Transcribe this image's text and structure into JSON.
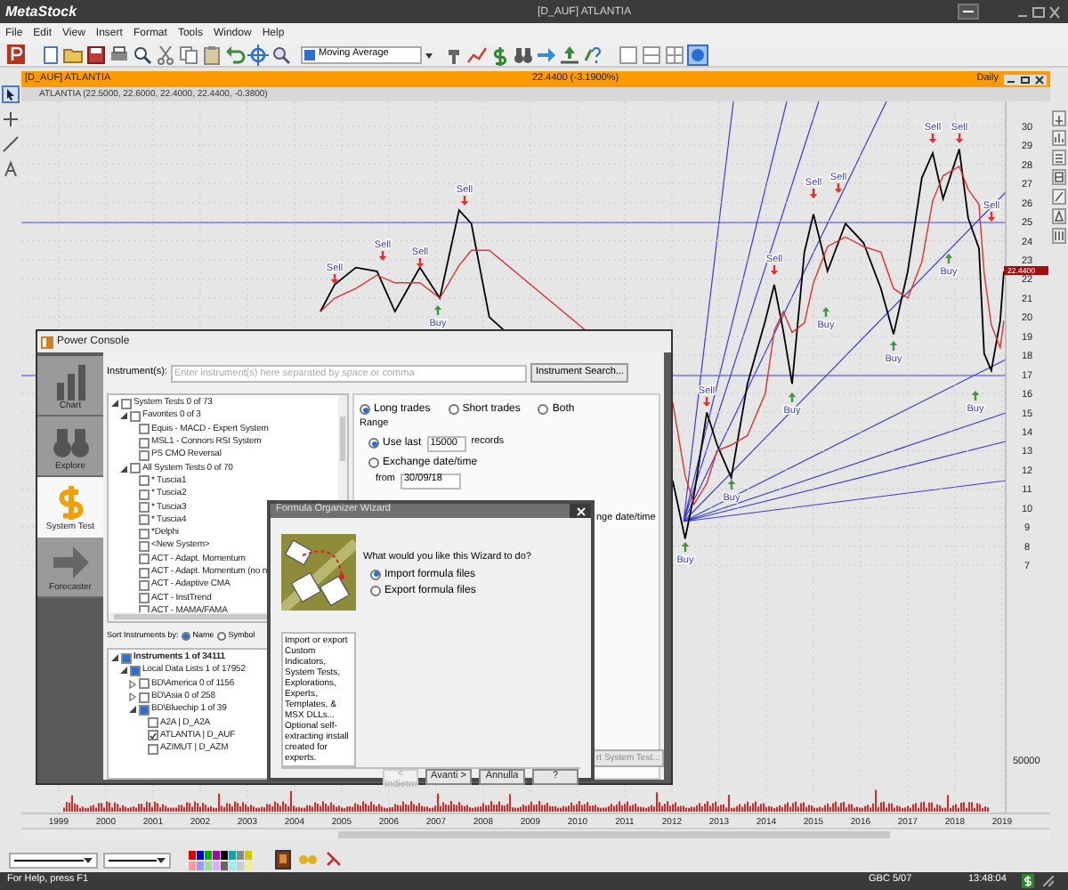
{
  "title_bar": {
    "app": "MetaStock",
    "document": "[D_AUF] ATLANTIA"
  },
  "menu": [
    "File",
    "Edit",
    "View",
    "Insert",
    "Format",
    "Tools",
    "Window",
    "Help"
  ],
  "toolbar": {
    "indicator": "Moving Average"
  },
  "chart_window": {
    "title": "[D_AUF] ATLANTIA",
    "quote": "22.4400 (-3.1900%)",
    "period": "Daily",
    "info": "ATLANTIA (22.5000, 22.6000, 22.4000, 22.4400, -0.3800)",
    "chart_data": {
      "type": "line",
      "x": [
        2004.55,
        2004.85,
        2005.3,
        2005.75,
        2006.13,
        2006.66,
        2007.08,
        2007.49,
        2007.75,
        2008.13,
        2012.02,
        2012.28,
        2012.47,
        2012.74,
        2012.96,
        2013.26,
        2013.6,
        2013.98,
        2014.17,
        2014.36,
        2014.55,
        2014.81,
        2015.0,
        2015.3,
        2015.68,
        2016.06,
        2016.43,
        2016.7,
        2017.0,
        2017.3,
        2017.53,
        2017.75,
        2018.09,
        2018.28,
        2018.51,
        2018.62,
        2018.77,
        2018.96,
        2019.04
      ],
      "series": [
        {
          "color": "#000000",
          "values": [
            20.3,
            21.7,
            22.6,
            22.4,
            20.3,
            22.6,
            21.0,
            25.6,
            24.9,
            20.0,
            11.4,
            8.4,
            10.7,
            15.0,
            13.3,
            11.6,
            16.5,
            19.8,
            21.7,
            19.3,
            16.5,
            23.4,
            25.4,
            22.4,
            24.9,
            23.9,
            21.5,
            19.1,
            22.4,
            27.3,
            28.6,
            26.2,
            28.8,
            25.2,
            23.6,
            18.1,
            17.2,
            19.8,
            22.4
          ]
        },
        {
          "color": "#e03030",
          "values": [
            20.3,
            21.0,
            21.5,
            22.2,
            21.8,
            21.8,
            21.0,
            22.7,
            23.5,
            23.5,
            15.5,
            11.7,
            10.2,
            11.3,
            13.0,
            13.3,
            13.8,
            16.0,
            19.3,
            20.3,
            19.2,
            19.7,
            21.8,
            23.7,
            24.2,
            23.7,
            23.4,
            21.5,
            21.0,
            22.9,
            26.1,
            27.4,
            27.9,
            26.7,
            25.9,
            22.3,
            19.6,
            18.4,
            19.8
          ]
        }
      ],
      "xlim": [
        1998.21,
        2020.02
      ],
      "ylim": [
        -6.0,
        31.3
      ],
      "grid": true,
      "yticks": [
        {
          "value": 30,
          "label": "30"
        },
        {
          "value": 29,
          "label": "29"
        },
        {
          "value": 28,
          "label": "28"
        },
        {
          "value": 27,
          "label": "27"
        },
        {
          "value": 26,
          "label": "26"
        },
        {
          "value": 25,
          "label": "25"
        },
        {
          "value": 24,
          "label": "24"
        },
        {
          "value": 23,
          "label": "23"
        },
        {
          "value": 22,
          "label": "22"
        },
        {
          "value": 21,
          "label": "21"
        },
        {
          "value": 20,
          "label": "20"
        },
        {
          "value": 19,
          "label": "19"
        },
        {
          "value": 18,
          "label": "18"
        },
        {
          "value": 17,
          "label": "17"
        },
        {
          "value": 16,
          "label": "16"
        },
        {
          "value": 15,
          "label": "15"
        },
        {
          "value": 14,
          "label": "14"
        },
        {
          "value": 13,
          "label": "13"
        },
        {
          "value": 12,
          "label": "12"
        },
        {
          "value": 11,
          "label": "11"
        },
        {
          "value": 10,
          "label": "10"
        },
        {
          "value": 9,
          "label": "9"
        },
        {
          "value": 8,
          "label": "8"
        },
        {
          "value": 7,
          "label": "7"
        }
      ],
      "xticks": [
        {
          "value": 1999,
          "label": "1999"
        },
        {
          "value": 2000,
          "label": "2000"
        },
        {
          "value": 2001,
          "label": "2001"
        },
        {
          "value": 2002,
          "label": "2002"
        },
        {
          "value": 2003,
          "label": "2003"
        },
        {
          "value": 2004,
          "label": "2004"
        },
        {
          "value": 2005,
          "label": "2005"
        },
        {
          "value": 2006,
          "label": "2006"
        },
        {
          "value": 2007,
          "label": "2007"
        },
        {
          "value": 2008,
          "label": "2008"
        },
        {
          "value": 2009,
          "label": "2009"
        },
        {
          "value": 2010,
          "label": "2010"
        },
        {
          "value": 2011,
          "label": "2011"
        },
        {
          "value": 2012,
          "label": "2012"
        },
        {
          "value": 2013,
          "label": "2013"
        },
        {
          "value": 2014,
          "label": "2014"
        },
        {
          "value": 2015,
          "label": "2015"
        },
        {
          "value": 2016,
          "label": "2016"
        },
        {
          "value": 2017,
          "label": "2017"
        },
        {
          "value": 2018,
          "label": "2018"
        },
        {
          "value": 2019,
          "label": "2019"
        }
      ]
    },
    "price_tag": "22.4400",
    "signals": [
      {
        "kind": "sell",
        "label": "Sell"
      },
      {
        "kind": "sell",
        "label": "Sell"
      },
      {
        "kind": "sell",
        "label": "Sell"
      },
      {
        "kind": "buy",
        "label": "Buy"
      },
      {
        "kind": "sell",
        "label": "Sell"
      },
      {
        "kind": "buy",
        "label": "Buy"
      },
      {
        "kind": "sell",
        "label": "Sell"
      },
      {
        "kind": "buy",
        "label": "Buy"
      },
      {
        "kind": "sell",
        "label": "Sell"
      },
      {
        "kind": "buy",
        "label": "Buy"
      },
      {
        "kind": "sell",
        "label": "Sell"
      },
      {
        "kind": "buy",
        "label": "Buy"
      },
      {
        "kind": "sell",
        "label": "Sell"
      },
      {
        "kind": "buy",
        "label": "Buy"
      },
      {
        "kind": "sell",
        "label": "Sell"
      },
      {
        "kind": "buy",
        "label": "Buy"
      },
      {
        "kind": "sell",
        "label": "Sell"
      },
      {
        "kind": "buy",
        "label": "Buy"
      },
      {
        "kind": "sell",
        "label": "Sell"
      }
    ],
    "volume_label": "50000"
  },
  "power_console": {
    "title": "Power Console",
    "nav": [
      {
        "label": "Chart",
        "selected": false
      },
      {
        "label": "Explore",
        "selected": false
      },
      {
        "label": "System Test",
        "selected": true
      },
      {
        "label": "Forecaster",
        "selected": false
      }
    ],
    "instrument_label": "Instrument(s):",
    "instrument_placeholder": "Enter instrument(s) here separated by space or comma",
    "search_button": "Instrument Search...",
    "system_tests": [
      {
        "label": "System Tests 0 of 73",
        "checked": false,
        "expanded": true,
        "children": [
          {
            "label": "Favorites 0 of 3",
            "checked": false,
            "expanded": true,
            "children": [
              {
                "label": "Equis - MACD - Expert System",
                "checked": false
              },
              {
                "label": "MSL1 - Connors RSI System",
                "checked": false
              },
              {
                "label": "PS CMO Reversal",
                "checked": false
              }
            ]
          },
          {
            "label": "All System Tests 0 of 70",
            "checked": false,
            "expanded": true,
            "children": [
              {
                "label": "* Tuscia1",
                "checked": false
              },
              {
                "label": "* Tuscia2",
                "checked": false
              },
              {
                "label": "* Tuscia3",
                "checked": false
              },
              {
                "label": "* Tuscia4",
                "checked": false
              },
              {
                "label": "*Delphi",
                "checked": false
              },
              {
                "label": "<New System>",
                "checked": false
              },
              {
                "label": "ACT - Adapt. Momentum",
                "checked": false
              },
              {
                "label": "ACT - Adapt. Momentum (no n",
                "checked": false
              },
              {
                "label": "ACT - Adaptive CMA",
                "checked": false
              },
              {
                "label": "ACT - InstTrend",
                "checked": false
              },
              {
                "label": "ACT - MAMA/FAMA",
                "checked": false
              }
            ]
          }
        ]
      }
    ],
    "sort_label": "Sort Instruments by:",
    "sort_options": [
      {
        "label": "Name",
        "selected": true
      },
      {
        "label": "Symbol",
        "selected": false
      }
    ],
    "instruments": [
      {
        "label": "Instruments 1 of 34111",
        "bold": true,
        "checked": false,
        "partial": true,
        "expanded": true,
        "children": [
          {
            "label": "Local Data Lists 1 of 17952",
            "checked": false,
            "partial": true,
            "expanded": true,
            "children": [
              {
                "label": "BD\\America 0 of 1156",
                "checked": false,
                "expanded": false
              },
              {
                "label": "BD\\Asia 0 of 258",
                "checked": false,
                "expanded": false
              },
              {
                "label": "BD\\Bluechip 1 of 39",
                "checked": false,
                "partial": true,
                "expanded": true,
                "children": [
                  {
                    "label": "A2A | D_A2A",
                    "checked": false
                  },
                  {
                    "label": "ATLANTIA | D_AUF",
                    "checked": true
                  },
                  {
                    "label": "AZIMUT | D_AZM",
                    "checked": false
                  }
                ]
              }
            ]
          }
        ]
      }
    ],
    "trade_options": [
      {
        "label": "Long trades",
        "selected": true
      },
      {
        "label": "Short trades",
        "selected": false
      },
      {
        "label": "Both",
        "selected": false
      }
    ],
    "range_label": "Range",
    "range_options": [
      {
        "label": "Use last",
        "selected": true
      },
      {
        "label": "Exchange date/time",
        "selected": false
      }
    ],
    "records_value": "15000",
    "records_label": "records",
    "from_label": "from",
    "from_value": "30/09/18",
    "hidden_option": "nge date/time",
    "run_button": "rt System Test..."
  },
  "wizard": {
    "title": "Formula Organizer Wizard",
    "description": "Import or export Custom Indicators, System Tests, Explorations, Experts, Templates, & MSX DLLs... Optional self-extracting install created for experts.",
    "question": "What would you like this Wizard to do?",
    "options": [
      {
        "label": "Import formula files",
        "selected": true
      },
      {
        "label": "Export formula files",
        "selected": false
      }
    ],
    "buttons": [
      {
        "label": "< Indietro",
        "disabled": true
      },
      {
        "label": "Avanti >",
        "disabled": false
      },
      {
        "label": "Annulla",
        "disabled": false
      },
      {
        "label": "?",
        "disabled": false
      }
    ]
  },
  "status_bar": {
    "help": "For Help, press F1",
    "text_2": "GBC 5/07",
    "time": "13:48:04"
  }
}
